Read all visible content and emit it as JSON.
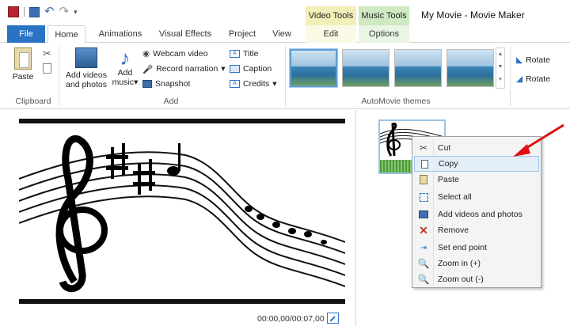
{
  "window": {
    "title": "My Movie - Movie Maker"
  },
  "context_groups": {
    "video": "Video Tools",
    "music": "Music Tools"
  },
  "tabs": {
    "file": "File",
    "home": "Home",
    "animations": "Animations",
    "visual_effects": "Visual Effects",
    "project": "Project",
    "view": "View",
    "edit": "Edit",
    "options": "Options"
  },
  "ribbon": {
    "paste": "Paste",
    "clipboard_group": "Clipboard",
    "add_videos_line1": "Add videos",
    "add_videos_line2": "and photos",
    "add_music_line1": "Add",
    "add_music_line2": "music",
    "webcam": "Webcam video",
    "record": "Record narration",
    "snapshot": "Snapshot",
    "title": "Title",
    "caption": "Caption",
    "credits": "Credits",
    "add_group": "Add",
    "automovie_group": "AutoMovie themes",
    "rotate_left": "Rotate",
    "rotate_right": "Rotate"
  },
  "preview": {
    "timecode": "00:00,00/00:07,00"
  },
  "context_menu": {
    "items": [
      {
        "label": "Cut",
        "icon": "scissors-icon"
      },
      {
        "label": "Copy",
        "icon": "copy-icon"
      },
      {
        "label": "Paste",
        "icon": "paste-icon"
      },
      {
        "label": "Select all",
        "icon": "select-all-icon"
      },
      {
        "label": "Add videos and photos",
        "icon": "add-media-icon"
      },
      {
        "label": "Remove",
        "icon": "remove-icon"
      },
      {
        "label": "Set end point",
        "icon": "end-point-icon"
      },
      {
        "label": "Zoom in (+)",
        "icon": "zoom-in-icon"
      },
      {
        "label": "Zoom out (-)",
        "icon": "zoom-out-icon"
      }
    ],
    "highlighted": "Copy"
  },
  "colors": {
    "accent": "#2a72c4",
    "annotation_arrow": "#e01010"
  }
}
